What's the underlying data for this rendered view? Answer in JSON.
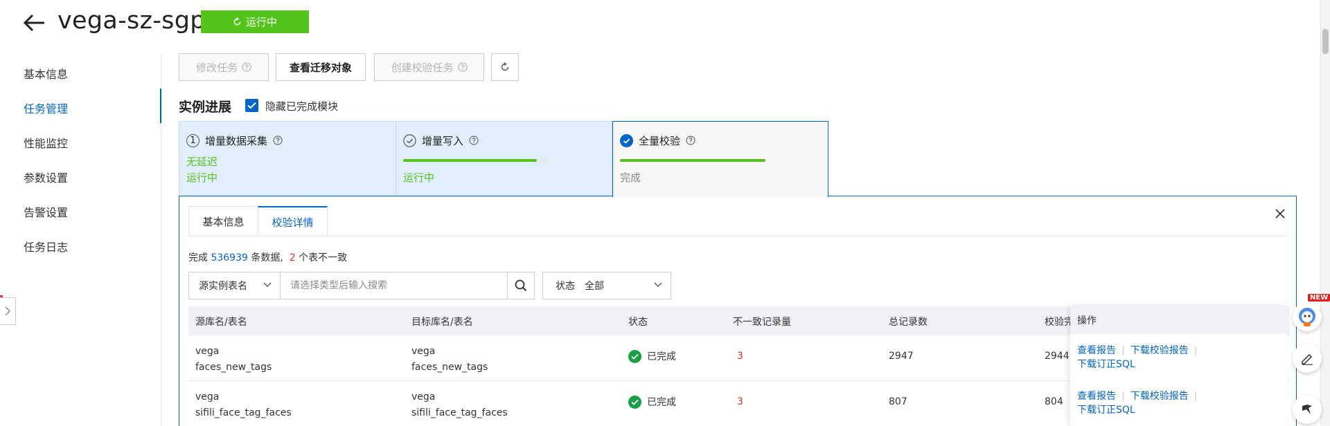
{
  "header": {
    "title": "vega-sz-sgp",
    "status_label": "运行中",
    "status_color": "#52c41a"
  },
  "sidebar": {
    "items": [
      {
        "label": "基本信息"
      },
      {
        "label": "任务管理",
        "active": true
      },
      {
        "label": "性能监控"
      },
      {
        "label": "参数设置"
      },
      {
        "label": "告警设置"
      },
      {
        "label": "任务日志"
      }
    ]
  },
  "toolbar": {
    "modify_label": "修改任务",
    "view_label": "查看迁移对象",
    "create_verify_label": "创建校验任务"
  },
  "progress_section": {
    "title": "实例进展",
    "hide_completed_label": "隐藏已完成模块",
    "hide_completed_checked": true,
    "steps": [
      {
        "index": "1",
        "name": "增量数据采集",
        "line1": "无延迟",
        "line2": "运行中"
      },
      {
        "name": "增量写入",
        "progress": 0.92,
        "line2": "运行中"
      },
      {
        "name": "全量校验",
        "progress": 1.0,
        "line2": "完成"
      }
    ]
  },
  "panel": {
    "tabs": [
      {
        "label": "基本信息"
      },
      {
        "label": "校验详情",
        "active": true
      }
    ],
    "summary": {
      "prefix": "完成 ",
      "count": "536939",
      "middle": " 条数据,  ",
      "inconsistent": "2",
      "suffix": " 个表不一致"
    },
    "filter": {
      "field_label": "源实例表名",
      "search_placeholder": "请选择类型后输入搜索",
      "status_label": "状态",
      "status_value": "全部"
    },
    "table": {
      "columns": [
        "源库名/表名",
        "目标库名/表名",
        "状态",
        "不一致记录量",
        "总记录数",
        "校验完成"
      ],
      "op_column": "操作",
      "rows": [
        {
          "src_db": "vega",
          "src_table": "faces_new_tags",
          "dst_db": "vega",
          "dst_table": "faces_new_tags",
          "status": "已完成",
          "inconsistent": "3",
          "total": "2947",
          "verified": "2944"
        },
        {
          "src_db": "vega",
          "src_table": "sifili_face_tag_faces",
          "dst_db": "vega",
          "dst_table": "sifili_face_tag_faces",
          "status": "已完成",
          "inconsistent": "3",
          "total": "807",
          "verified": "804"
        }
      ],
      "ops": {
        "view_report": "查看报告",
        "download_report": "下载校验报告",
        "download_sql": "下载订正SQL"
      }
    }
  },
  "floating": {
    "new_badge": "NEW"
  }
}
